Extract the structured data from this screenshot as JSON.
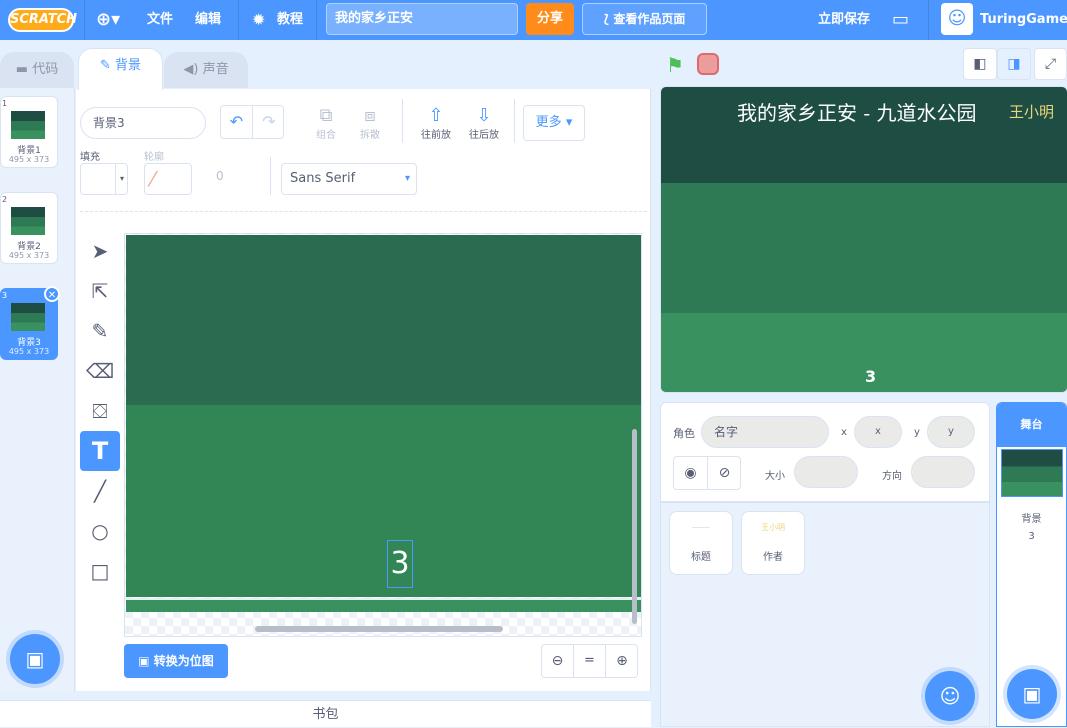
{
  "menubar": {
    "logo": "SCRATCH",
    "file": "文件",
    "edit": "编辑",
    "tutorials": "教程",
    "project_title": "我的家乡正安",
    "share": "分享",
    "see_project": "查看作品页面",
    "save_now": "立即保存",
    "username": "TuringGame"
  },
  "tabs": {
    "code": "代码",
    "backdrops": "背景",
    "sounds": "声音"
  },
  "backdrops": [
    {
      "num": "1",
      "name": "背景1",
      "size": "495 x 373"
    },
    {
      "num": "2",
      "name": "背景2",
      "size": "495 x 373"
    },
    {
      "num": "3",
      "name": "背景3",
      "size": "495 x 373"
    }
  ],
  "editor": {
    "costume_name": "背景3",
    "group": "组合",
    "ungroup": "拆散",
    "forward": "往前放",
    "backward": "往后放",
    "more": "更多",
    "fill_label": "填充",
    "outline_label": "轮廓",
    "outline_width": "0",
    "font": "Sans Serif",
    "canvas_text": "3",
    "convert_bitmap": "转换为位图",
    "zoom_reset": "="
  },
  "stage": {
    "title": "我的家乡正安 - 九道水公园",
    "author": "王小明",
    "number": "3"
  },
  "sprite_info": {
    "sprite_label": "角色",
    "name_placeholder": "名字",
    "x_label": "x",
    "x_placeholder": "x",
    "y_label": "y",
    "y_placeholder": "y",
    "size_label": "大小",
    "direction_label": "方向"
  },
  "sprites": [
    {
      "name": "标题",
      "thumb_text": "———"
    },
    {
      "name": "作者",
      "thumb_text": "王小明"
    }
  ],
  "stage_panel": {
    "header": "舞台",
    "label": "背景",
    "count": "3"
  },
  "backpack": "书包",
  "colors": {
    "brand": "#4c97ff",
    "orange": "#ff8c1a",
    "stage_dark": "#1e4d43",
    "stage_mid": "#2e7a54",
    "stage_light": "#3a9160"
  }
}
